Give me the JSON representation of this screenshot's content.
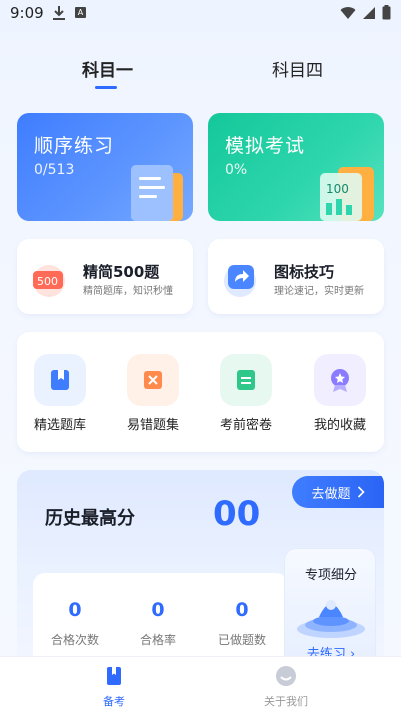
{
  "status_bar": {
    "time": "9:09",
    "a_label": "A"
  },
  "tabs": [
    {
      "label": "科目一",
      "active": true
    },
    {
      "label": "科目四",
      "active": false
    }
  ],
  "cards": {
    "sequential": {
      "title": "顺序练习",
      "progress": "0/513"
    },
    "mock_exam": {
      "title": "模拟考试",
      "progress": "0%",
      "icon_text": "100"
    }
  },
  "features": {
    "selected_500": {
      "title": "精简500题",
      "subtitle": "精简题库，知识秒懂",
      "icon_text": "500"
    },
    "icon_skills": {
      "title": "图标技巧",
      "subtitle": "理论速记，实时更新"
    }
  },
  "quick_actions": [
    {
      "label": "精选题库",
      "icon": "bookmark-book-icon",
      "color": "#3f7dff"
    },
    {
      "label": "易错题集",
      "icon": "wrong-note-icon",
      "color": "#ff8a4c"
    },
    {
      "label": "考前密卷",
      "icon": "exam-paper-icon",
      "color": "#2fc88a"
    },
    {
      "label": "我的收藏",
      "icon": "favorite-badge-icon",
      "color": "#8b7cff"
    }
  ],
  "score": {
    "title": "历史最高分",
    "value": "00",
    "action": "去做题",
    "stats": [
      {
        "value": "0",
        "label": "合格次数"
      },
      {
        "value": "0",
        "label": "合格率"
      },
      {
        "value": "0",
        "label": "已做题数"
      }
    ]
  },
  "special": {
    "title": "专项细分",
    "link": "去练习"
  },
  "bottom_nav": [
    {
      "label": "备考",
      "active": true
    },
    {
      "label": "关于我们",
      "active": false
    }
  ],
  "colors": {
    "primary": "#2f6bff",
    "green": "#14c89a"
  }
}
